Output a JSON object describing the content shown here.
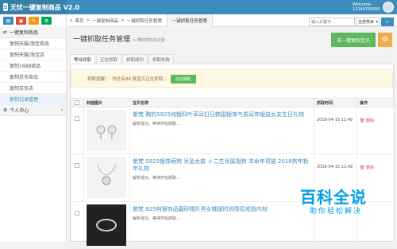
{
  "app": {
    "title": "无忧一键复制商品 V2.0"
  },
  "user": {
    "greeting": "Welcome,",
    "account": "12344789995"
  },
  "sidebar": {
    "tile_colors": [
      "#3c8dbc",
      "#dd4b39",
      "#f39c12",
      "#00a65a"
    ],
    "group1": "一键复制商品",
    "items": [
      "复制天猫/淘宝商品",
      "复制天猫/淘宝店",
      "复制1688商品",
      "复制京东商品",
      "复制京东店",
      "复制记录管理"
    ],
    "group2": "个人中心"
  },
  "breadcrumb": {
    "home": "首页",
    "sep": ">",
    "level1": "一键复制商品",
    "level2": "一键抓取任务管理"
  },
  "tab_title": "一键抓取任务管理",
  "search": {
    "placeholder": "输入关键字...",
    "select": "全部类目"
  },
  "page": {
    "title": "一键抓取任务管理",
    "subtitle": "> 带你搜的的记录"
  },
  "buttons": {
    "collect": "去一键复制宝贝",
    "gear": "⚙"
  },
  "tabs": [
    "等待抓取",
    "正在抓取",
    "抓取成功",
    "抓取失败"
  ],
  "alert": {
    "label": "抓取提醒：",
    "text": "你还有88 款宝贝正在抓取...",
    "button": "点击刷新"
  },
  "table": {
    "headers": [
      "",
      "封面图片",
      "宝贝名称",
      "抓取时间",
      "操作"
    ],
    "rows": [
      {
        "name": "紫梵 胸钓S925纯银四叶草耳钉日韩国银饰气质耳饰银送女友生日礼物",
        "status": "解析成功，等待开始抓取...",
        "time": "2018-04-15 11:49",
        "action": "删除"
      },
      {
        "name": "紫梵 S925银饰萌狗 吊坠女款 十二生肖属相狗 本命年项链 2018狗年新年礼物",
        "status": "解析成功，等待开始抓取...",
        "time": "2018-04-15 11:49",
        "action": "删除"
      },
      {
        "name": "紫梵 925纯银饰品磨砂精片男女韩版时尚情侣戒指内刻",
        "status": "解析成功，等待开始抓取...",
        "time": "",
        "action": ""
      }
    ]
  },
  "watermark": {
    "title": "百科全说",
    "subtitle": "助你轻松解决"
  }
}
